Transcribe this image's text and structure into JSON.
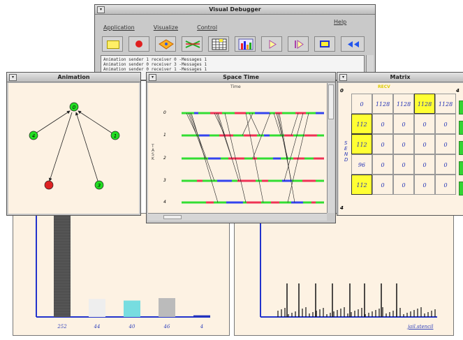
{
  "visual_debugger": {
    "title": "Visual Debugger",
    "menu": [
      "Application",
      "Visualize",
      "Control",
      "Help"
    ],
    "log_lines": [
      "Animation sender 1 receiver 0 -Messages 1",
      "Animation sender 0 receiver 3 -Messages 1",
      "Animation sender 0 receiver 1 -Messages 1"
    ],
    "tool_icons": [
      "rectangle-icon",
      "record-icon",
      "diamond-icon",
      "arrows-icon",
      "grid-icon",
      "bar-chart-icon",
      "play-icon",
      "step-icon",
      "stop-icon",
      "rewind-icon"
    ]
  },
  "animation": {
    "title": "Animation",
    "nodes": [
      {
        "label": "0",
        "color": "#22dd22"
      },
      {
        "label": "4",
        "color": "#22dd22"
      },
      {
        "label": "1",
        "color": "#22dd22"
      },
      {
        "label": "",
        "color": "#dd2222"
      },
      {
        "label": "3",
        "color": "#22dd22"
      }
    ]
  },
  "space_time": {
    "title": "Space Time",
    "axis_label": "Time",
    "side_label": "TASK",
    "task_labels": [
      "0",
      "1",
      "2",
      "3",
      "4"
    ]
  },
  "matrix": {
    "title": "Matrix",
    "top_label": "RECV",
    "side_label": "SEND",
    "corner_top_left": "0",
    "corner_top_right": "4",
    "corner_bottom_left": "4",
    "cells": [
      [
        "0",
        "1128",
        "1128",
        "1128",
        "1128"
      ],
      [
        "112",
        "0",
        "0",
        "0",
        "0"
      ],
      [
        "112",
        "0",
        "0",
        "0",
        "0"
      ],
      [
        "96",
        "0",
        "0",
        "0",
        "0"
      ],
      [
        "112",
        "0",
        "0",
        "0",
        "0"
      ]
    ],
    "highlight_color": "#ffff33"
  },
  "bar_window": {
    "chart_data": {
      "type": "bar",
      "categories": [
        "252",
        "44",
        "40",
        "46",
        "4"
      ],
      "values": [
        252,
        44,
        40,
        46,
        4
      ],
      "colors": [
        "#555555",
        "#eeeeee",
        "#77dde0",
        "#bbbbbb",
        "#2233bb"
      ],
      "ylim": [
        0,
        252
      ]
    }
  },
  "spike_window": {
    "label": "jail.stencil"
  }
}
